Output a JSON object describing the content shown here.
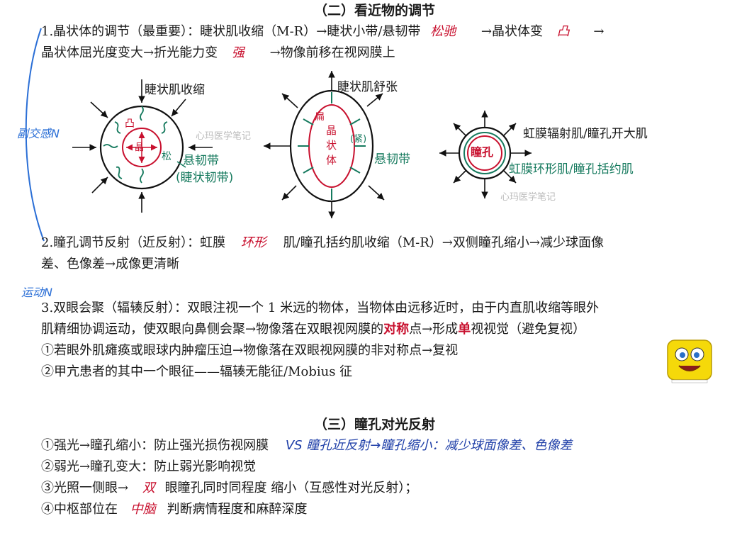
{
  "section2": {
    "title": "（二）看近物的调节",
    "p1_line1_a": "1.晶状体的调节（最重要）：睫状肌收缩（M-R）→睫状小带/悬韧带",
    "p1_line1_red": "松驰",
    "p1_line1_b": "→晶状体变",
    "p1_line1_red2": "凸",
    "p1_line1_c": "→",
    "p1_line2_a": "晶状体屈光度变大→折光能力变",
    "p1_line2_red": "强",
    "p1_line2_b": "→物像前移在视网膜上"
  },
  "diagram": {
    "left_top_label": "睫状肌收缩",
    "left_center": "晶",
    "left_convex": "凸",
    "left_loose": "松",
    "left_lig1": "悬韧带",
    "left_lig2": "(睫状韧带)",
    "mid_top_label": "睫状肌舒张",
    "mid_flat": "扁",
    "mid_center": "晶\n状\n体",
    "mid_tight": "(紧)",
    "mid_lig": "悬韧带",
    "right_center": "瞳孔",
    "right_label1": "虹膜辐射肌/瞳孔开大肌",
    "right_label2": "虹膜环形肌/瞳孔括约肌",
    "watermark": "心玛医学笔记"
  },
  "notes": {
    "sympathetic": "副交感N",
    "motor": "运动N"
  },
  "para2": {
    "line1_a": "2.瞳孔调节反射（近反射）：虹膜",
    "line1_red": "环形",
    "line1_b": "肌/瞳孔括约肌收缩（M-R）→双侧瞳孔缩小→减少球面像",
    "line2": "差、色像差→成像更清晰"
  },
  "para3": {
    "line1": "3.双眼会聚（辐辏反射）：双眼注视一个 1 米远的物体，当物体由远移近时，由于内直肌收缩等眼外",
    "line2_a": "肌精细协调运动，使双眼向鼻侧会聚→物像落在双眼视网膜的",
    "line2_red": "对称",
    "line2_b": "点→形成",
    "line2_red2": "单",
    "line2_c": "视视觉（避免复视）",
    "line3": "①若眼外肌瘫痪或眼球内肿瘤压迫→物像落在双眼视网膜的非对称点→复视",
    "line4": "②甲亢患者的其中一个眼征——辐辏无能征/Mobius 征"
  },
  "section3": {
    "title": "（三）瞳孔对光反射",
    "item1": "①强光→瞳孔缩小：防止强光损伤视网膜",
    "item1_blue": "VS  瞳孔近反射→瞳孔缩小：减少球面像差、色像差",
    "item2": "②弱光→瞳孔变大：防止弱光影响视觉",
    "item3_a": "③光照一侧眼→",
    "item3_red": "双",
    "item3_b": "眼瞳孔同时同程度 缩小（互感性对光反射）；",
    "item4_a": "④中枢部位在",
    "item4_red": "中脑",
    "item4_b": "判断病情程度和麻醉深度"
  },
  "colors": {
    "red": "#c8102e",
    "green": "#167a5e",
    "blue": "#1f3fa8",
    "note": "#2b6fd6"
  }
}
